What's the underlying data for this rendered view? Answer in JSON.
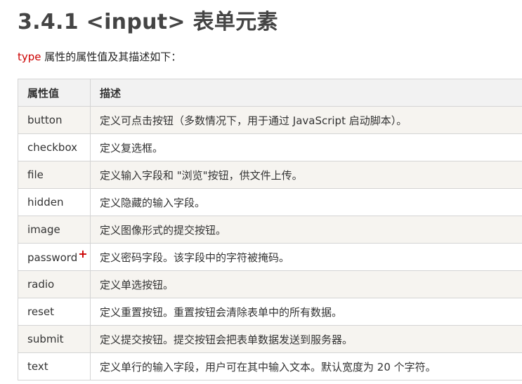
{
  "heading": "3.4.1 <input> 表单元素",
  "intro": {
    "keyword": "type",
    "text": " 属性的属性值及其描述如下："
  },
  "table": {
    "headers": [
      "属性值",
      "描述"
    ],
    "rows": [
      {
        "value": "button",
        "desc": "定义可点击按钮（多数情况下，用于通过 JavaScript 启动脚本）。"
      },
      {
        "value": "checkbox",
        "desc": "定义复选框。"
      },
      {
        "value": "file",
        "desc": "定义输入字段和 \"浏览\"按钮，供文件上传。"
      },
      {
        "value": "hidden",
        "desc": "定义隐藏的输入字段。"
      },
      {
        "value": "image",
        "desc": "定义图像形式的提交按钮。"
      },
      {
        "value": "password",
        "mark": "+",
        "desc": "定义密码字段。该字段中的字符被掩码。"
      },
      {
        "value": "radio",
        "desc": "定义单选按钮。"
      },
      {
        "value": "reset",
        "desc": "定义重置按钮。重置按钮会清除表单中的所有数据。"
      },
      {
        "value": "submit",
        "desc": "定义提交按钮。提交按钮会把表单数据发送到服务器。"
      },
      {
        "value": "text",
        "desc": "定义单行的输入字段，用户可在其中输入文本。默认宽度为 20 个字符。"
      }
    ]
  },
  "colors": {
    "keyword": "#cc0000",
    "row_alt": "#f6f4f0",
    "header_bg": "#f2f2f2",
    "border": "#d4d4d4"
  }
}
